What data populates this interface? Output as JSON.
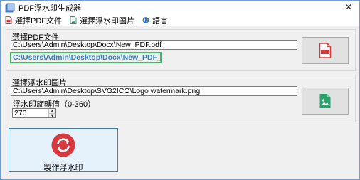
{
  "window": {
    "title": "PDF浮水印生成器",
    "close_glyph": "✕",
    "title_icon": "document-stack-icon"
  },
  "menu": {
    "items": [
      {
        "label": "選擇PDF文件",
        "icon": "pdf-file-icon",
        "color": "#d93a3a"
      },
      {
        "label": "選擇浮水印圖片",
        "icon": "image-file-icon",
        "color": "#2aa36a"
      },
      {
        "label": "語言",
        "icon": "globe-icon",
        "color": "#2e6fc4"
      }
    ]
  },
  "pdf_group": {
    "title": "選擇PDF文件",
    "input_path": "C:\\Users\\Admin\\Desktop\\Docx\\New_PDF.pdf",
    "output_path": "C:\\Users\\Admin\\Desktop\\Docx\\New_PDF_New.pdf",
    "button_icon": "pdf-file-icon",
    "output_border_color": "#3dba6a",
    "output_text_color": "#2e84c9"
  },
  "watermark_group": {
    "title": "選擇浮水印圖片",
    "image_path": "C:\\Users\\Admin\\Desktop\\SVG2ICO\\Logo watermark.png",
    "rotation_label": "浮水印旋轉值（0-360）",
    "rotation_value": "270",
    "button_icon": "image-file-icon"
  },
  "make_button": {
    "label": "製作浮水印",
    "icon": "refresh-icon",
    "icon_color": "#d63a3f"
  }
}
